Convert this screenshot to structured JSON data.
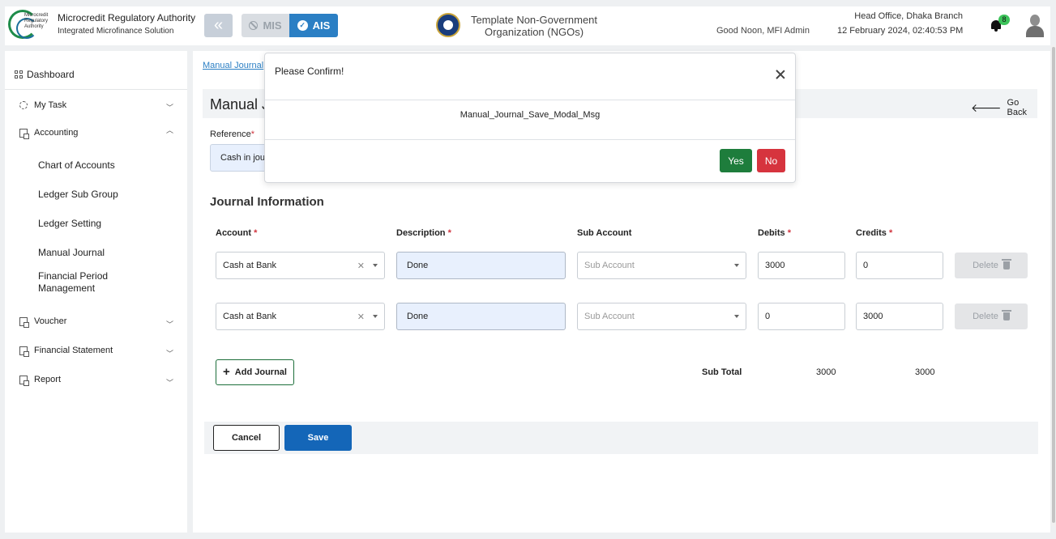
{
  "header": {
    "logo_text": "Microcredit Regulatory Authority",
    "org_name": "Microcredit Regulatory Authority",
    "org_subtitle": "Integrated Microfinance Solution",
    "mode_mis": "MIS",
    "mode_ais": "AIS",
    "template_org_line1": "Template Non-Government",
    "template_org_line2": "Organization (NGOs)",
    "greeting": "Good Noon, MFI Admin",
    "branch": "Head Office, Dhaka Branch",
    "datetime": "12 February 2024, 02:40:53 PM",
    "notification_count": "8"
  },
  "sidebar": {
    "dashboard": "Dashboard",
    "items": [
      {
        "label": "My Task"
      },
      {
        "label": "Accounting"
      },
      {
        "label": "Voucher"
      },
      {
        "label": "Financial Statement"
      },
      {
        "label": "Report"
      }
    ],
    "accounting_sub": [
      {
        "label": "Chart of Accounts"
      },
      {
        "label": "Ledger Sub Group"
      },
      {
        "label": "Ledger Setting"
      },
      {
        "label": "Manual Journal"
      },
      {
        "label": "Financial Period Management"
      }
    ]
  },
  "main": {
    "breadcrumb": "Manual Journal",
    "page_title": "Manual J",
    "go_back": "Go Back",
    "reference_label": "Reference",
    "reference_value": "Cash in journal",
    "section_title": "Journal Information",
    "columns": {
      "account": "Account",
      "description": "Description",
      "sub_account": "Sub Account",
      "debits": "Debits",
      "credits": "Credits"
    },
    "rows": [
      {
        "account": "Cash at Bank",
        "description": "Done",
        "sub_account_placeholder": "Sub Account",
        "debit": "3000",
        "credit": "0",
        "delete": "Delete"
      },
      {
        "account": "Cash at Bank",
        "description": "Done",
        "sub_account_placeholder": "Sub Account",
        "debit": "0",
        "credit": "3000",
        "delete": "Delete"
      }
    ],
    "add_journal": "Add Journal",
    "subtotal_label": "Sub Total",
    "subtotal_debit": "3000",
    "subtotal_credit": "3000",
    "cancel": "Cancel",
    "save": "Save"
  },
  "modal": {
    "title": "Please Confirm!",
    "message": "Manual_Journal_Save_Modal_Msg",
    "yes": "Yes",
    "no": "No"
  },
  "colors": {
    "primary": "#1466b8",
    "ais_active": "#2b7fc4",
    "yes": "#1e7d3c",
    "no": "#d6343e",
    "badge": "#3cc35a"
  }
}
